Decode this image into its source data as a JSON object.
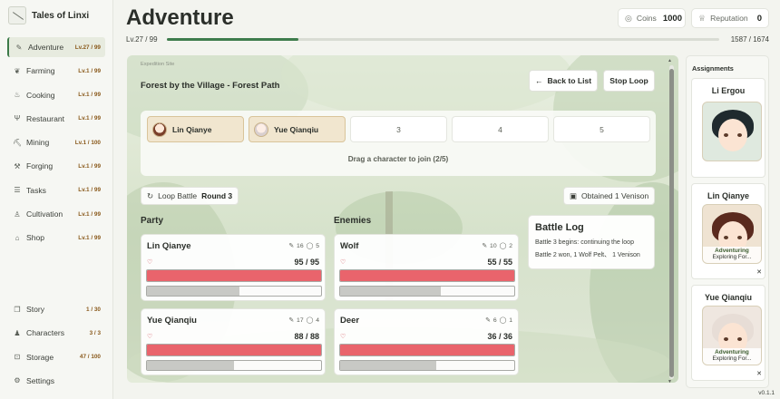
{
  "app": {
    "title": "Tales of Linxi",
    "version": "v0.1.1"
  },
  "sidebar": {
    "items": [
      {
        "label": "Adventure",
        "level": "Lv.27 / 99",
        "icon": "✎",
        "active": true
      },
      {
        "label": "Farming",
        "level": "Lv.1 / 99",
        "icon": "❦"
      },
      {
        "label": "Cooking",
        "level": "Lv.1 / 99",
        "icon": "♨"
      },
      {
        "label": "Restaurant",
        "level": "Lv.1 / 99",
        "icon": "Ψ"
      },
      {
        "label": "Mining",
        "level": "Lv.1 / 100",
        "icon": "⛏"
      },
      {
        "label": "Forging",
        "level": "Lv.1 / 99",
        "icon": "⚒"
      },
      {
        "label": "Tasks",
        "level": "Lv.1 / 99",
        "icon": "☰"
      },
      {
        "label": "Cultivation",
        "level": "Lv.1 / 99",
        "icon": "♙"
      },
      {
        "label": "Shop",
        "level": "Lv.1 / 99",
        "icon": "⌂"
      }
    ],
    "bottom_items": [
      {
        "label": "Story",
        "level": "1 / 30",
        "icon": "❐"
      },
      {
        "label": "Characters",
        "level": "3 / 3",
        "icon": "♟"
      },
      {
        "label": "Storage",
        "level": "47 / 100",
        "icon": "⊡"
      },
      {
        "label": "Settings",
        "level": "",
        "icon": "⚙"
      }
    ]
  },
  "header": {
    "title": "Adventure",
    "coins_label": "Coins",
    "coins_value": "1000",
    "reputation_label": "Reputation",
    "reputation_value": "0",
    "level_text": "Lv.27 / 99",
    "xp_text": "1587 / 1674",
    "xp_fraction": 0.2375
  },
  "expedition": {
    "site_label": "Expedition Site",
    "title": "Forest by the Village - Forest Path",
    "back_label": "Back to List",
    "stop_label": "Stop Loop",
    "slots": [
      {
        "label": "Lin Qianye",
        "filled": true
      },
      {
        "label": "Yue Qianqiu",
        "filled": true
      },
      {
        "label": "3",
        "filled": false
      },
      {
        "label": "4",
        "filled": false
      },
      {
        "label": "5",
        "filled": false
      }
    ],
    "hint": "Drag a character to join (2/5)",
    "loop_label": "Loop Battle",
    "round_label": "Round 3",
    "obtained": "Obtained 1 Venison"
  },
  "party": {
    "title": "Party",
    "members": [
      {
        "name": "Lin Qianye",
        "atk": "16",
        "def": "5",
        "hp": "95 / 95",
        "hp_fraction": 1.0,
        "cd_fraction": 0.53
      },
      {
        "name": "Yue Qianqiu",
        "atk": "17",
        "def": "4",
        "hp": "88 / 88",
        "hp_fraction": 1.0,
        "cd_fraction": 0.5
      }
    ]
  },
  "enemies": {
    "title": "Enemies",
    "members": [
      {
        "name": "Wolf",
        "atk": "10",
        "def": "2",
        "hp": "55 / 55",
        "hp_fraction": 1.0,
        "cd_fraction": 0.58
      },
      {
        "name": "Deer",
        "atk": "6",
        "def": "1",
        "hp": "36 / 36",
        "hp_fraction": 1.0,
        "cd_fraction": 0.55
      }
    ]
  },
  "battle_log": {
    "title": "Battle Log",
    "lines": [
      "Battle 3 begins: continuing the loop",
      "Battle 2 won, 1 Wolf Pelt、 1 Venison"
    ]
  },
  "assignments": {
    "title": "Assignments",
    "cards": [
      {
        "name": "Li Ergou",
        "status": "",
        "sub": "",
        "hair": "#1f2a2e",
        "bg": "#dfe9df"
      },
      {
        "name": "Lin Qianye",
        "status": "Adventuring",
        "sub": "Exploring For...",
        "hair": "#5a2a1e",
        "bg": "#efe3d2"
      },
      {
        "name": "Yue Qianqiu",
        "status": "Adventuring",
        "sub": "Exploring For...",
        "hair": "#e7ddd6",
        "bg": "#efe7e0"
      }
    ]
  },
  "colors": {
    "accent": "#3e7c4c",
    "hp": "#e9646c",
    "level_text": "#8a5a1c"
  }
}
